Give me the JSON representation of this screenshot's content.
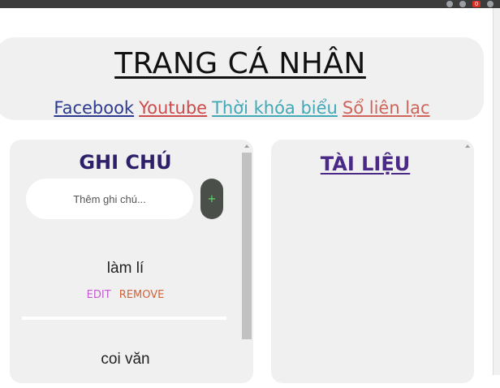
{
  "browser": {
    "extension_badge": "0"
  },
  "header": {
    "title": "TRANG CÁ NHÂN",
    "links": [
      {
        "label": "Facebook",
        "color": "#2b3a8f"
      },
      {
        "label": "Youtube",
        "color": "#cf4a4a"
      },
      {
        "label": "Thời khóa biểu",
        "color": "#3fa9b8"
      },
      {
        "label": "Sổ liên lạc",
        "color": "#d0645a"
      }
    ]
  },
  "notes_panel": {
    "title": "GHI CHÚ",
    "input": {
      "value": "",
      "placeholder": "Thêm ghi chú..."
    },
    "add_button_label": "+",
    "items": [
      {
        "text": "làm lí",
        "edit_label": "EDIT",
        "remove_label": "REMOVE"
      },
      {
        "text": "coi văn"
      }
    ]
  },
  "docs_panel": {
    "title": "TÀI LIỆU"
  },
  "colors": {
    "panel_bg": "#f0f0f0",
    "notes_title": "#2e1f6b",
    "docs_title": "#4a2a86",
    "add_button_bg": "#4a4f4a",
    "add_button_fg": "#5fe36a",
    "edit": "#c45ad3",
    "remove": "#d0643a"
  }
}
